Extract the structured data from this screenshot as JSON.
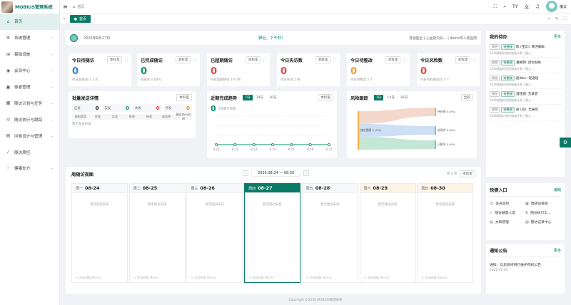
{
  "app": {
    "title": "MOBIUS管理系统"
  },
  "sidebar": {
    "items": [
      {
        "label": "首页",
        "icon": "home-icon",
        "glyph": "⌂",
        "active": true,
        "chevron": false
      },
      {
        "label": "系统管理",
        "icon": "gear-icon",
        "glyph": "⚙",
        "chevron": true
      },
      {
        "label": "基础设施",
        "icon": "cart-icon",
        "glyph": "⊞",
        "chevron": true
      },
      {
        "label": "会员中心",
        "icon": "user-icon",
        "glyph": "◉",
        "chevron": true
      },
      {
        "label": "患者管理",
        "icon": "patient-icon",
        "glyph": "▣",
        "chevron": true
      },
      {
        "label": "随访计划与任务",
        "icon": "calendar-icon",
        "glyph": "▦",
        "chevron": true
      },
      {
        "label": "随访执行与跟踪",
        "icon": "eye-icon",
        "glyph": "◎",
        "chevron": true
      },
      {
        "label": "问卷设计与管理",
        "icon": "document-icon",
        "glyph": "▤",
        "chevron": true
      },
      {
        "label": "随访质控",
        "icon": "check-icon",
        "glyph": "✓",
        "chevron": false
      },
      {
        "label": "健康处方",
        "icon": "heart-icon",
        "glyph": "♡",
        "chevron": true
      }
    ]
  },
  "header": {
    "breadcrumb": "首页",
    "username": "魔云"
  },
  "tabs": {
    "current": "首页"
  },
  "welcome": {
    "date": "2026年8月27日",
    "greeting": "雅迟，下午好!",
    "org": "普通医生 | 心血管内科一 | demo市人民医院"
  },
  "stats": [
    {
      "title": "今日待随访",
      "select": "本科室",
      "value": "0",
      "sub": "待日本随访 0 人次",
      "color": "blue"
    },
    {
      "title": "已完成随访",
      "select": "本科室",
      "value": "0",
      "sub": "完成率 0.00%",
      "color": "green"
    },
    {
      "title": "已超期随访",
      "select": "本科室",
      "value": "0",
      "sub": "待日超期随访 170 例",
      "color": "red"
    },
    {
      "title": "今日失访数",
      "select": "本科室",
      "value": "0",
      "sub": "待日失访 2 例",
      "color": "red"
    },
    {
      "title": "今日待整改",
      "select": "本科室",
      "value": "0",
      "sub": "待日待整改 5 个",
      "color": "orange"
    },
    {
      "title": "今日风险数",
      "select": "本科室",
      "value": "0",
      "sub": "待日待危报风险 3 个",
      "color": "red"
    }
  ],
  "batch": {
    "title": "批量发送详情",
    "select": "本科室",
    "row": [
      {
        "label": "应发",
        "value": "0"
      },
      {
        "label": "实发",
        "value": "0"
      },
      {
        "label": "失败",
        "value": "0"
      },
      {
        "label": "待发",
        "value": "0"
      }
    ],
    "columns": [
      "规则类型",
      "应发",
      "实发",
      "失败",
      "待发",
      "成功率",
      "最近执行时间"
    ],
    "empty": "暂无发送记录"
  },
  "trend": {
    "title": "近期完成趋势",
    "tabs": [
      "7日",
      "14日",
      "30日"
    ],
    "select": "本科室",
    "total": "0",
    "total_label": "7日累计完成"
  },
  "risk": {
    "title": "风险跟踪",
    "tabs": [
      "7日",
      "14日",
      "30日"
    ],
    "scope": "全院",
    "source": "随访提醒 0 (0%)",
    "targets": [
      "待处理 0 (0%)",
      "处理中 0 (0%)",
      "已解决 0 (0%)"
    ],
    "colors": [
      "#f6ab4b",
      "#e8a88f",
      "#8fb8e8",
      "#7dc7a1"
    ]
  },
  "chart_data": {
    "type": "line",
    "title": "近期完成趋势",
    "categories": [
      "8.21",
      "8.22",
      "8.23",
      "8.24",
      "8.25",
      "8.26",
      "8.27"
    ],
    "series": [
      {
        "values": [
          0,
          0,
          0,
          0,
          0,
          0,
          0
        ]
      }
    ],
    "color": "#0a8f6e",
    "grid": true
  },
  "week": {
    "title": "周随访视图",
    "range": "2026.08.24 — 08.30",
    "count": "共 0 项",
    "select": "本科室",
    "empty": "暂无随访安排",
    "memo": "✎ 添加周备 Memo",
    "days": [
      {
        "weekday": "周一",
        "date": "08-24",
        "today": false,
        "weekend": false
      },
      {
        "weekday": "周二",
        "date": "08-25",
        "today": false,
        "weekend": false
      },
      {
        "weekday": "周三",
        "date": "08-26",
        "today": false,
        "weekend": false
      },
      {
        "weekday": "周四",
        "date": "08-27",
        "today": true,
        "weekend": false
      },
      {
        "weekday": "周五",
        "date": "08-28",
        "today": false,
        "weekend": false
      },
      {
        "weekday": "周六",
        "date": "08-29",
        "today": false,
        "weekend": true
      },
      {
        "weekday": "周日",
        "date": "08-30",
        "today": false,
        "weekend": true
      }
    ]
  },
  "todos": {
    "title": "我的待办",
    "more": "更多",
    "items": [
      {
        "tag1": "质控",
        "tag2": "待整改",
        "title": "陈 (宝云): 黄河脚本",
        "desc": "2026版临时质控抽查计划 / 截止 ..."
      },
      {
        "tag1": "质控",
        "tag2": "待整改",
        "title": "潘朔玥: 肾科缺失",
        "desc": "2026版临时质控抽查计划 / 截止 ..."
      },
      {
        "tag1": "质控",
        "tag2": "待整改",
        "title": "赵Wen: 轻通话",
        "desc": "2026版临时质控抽查计划 / 截止 ..."
      },
      {
        "tag1": "质控",
        "tag2": "待整改",
        "title": "温钰涵: 无录音",
        "desc": "2026版临时质控抽查计划 / 截止 ..."
      },
      {
        "tag1": "质控",
        "tag2": "待整改",
        "title": "徐 (京): 无录音",
        "desc": "2026版临时质控抽查计划 / 截止 ..."
      }
    ]
  },
  "quick": {
    "title": "快捷入口",
    "edit": "编辑",
    "items": [
      {
        "label": "会员签约",
        "icon": "sign-icon",
        "glyph": "☺"
      },
      {
        "label": "周随访排程",
        "icon": "schedule-icon",
        "glyph": "▦"
      },
      {
        "label": "随访做量入选",
        "icon": "check-icon",
        "glyph": "✓"
      },
      {
        "label": "随访执行工...",
        "icon": "phone-icon",
        "glyph": "✆"
      },
      {
        "label": "文章管理",
        "icon": "article-icon",
        "glyph": "▤"
      },
      {
        "label": "随访记录中心",
        "icon": "record-icon",
        "glyph": "▤"
      }
    ]
  },
  "notice": {
    "title": "通知公告",
    "more": "更多",
    "text": "通知：信息系统例行维护停机公告",
    "date": "2021-01-05"
  },
  "footer": {
    "copyright": "Copyright ©2026 MOBIUS管理系统"
  }
}
